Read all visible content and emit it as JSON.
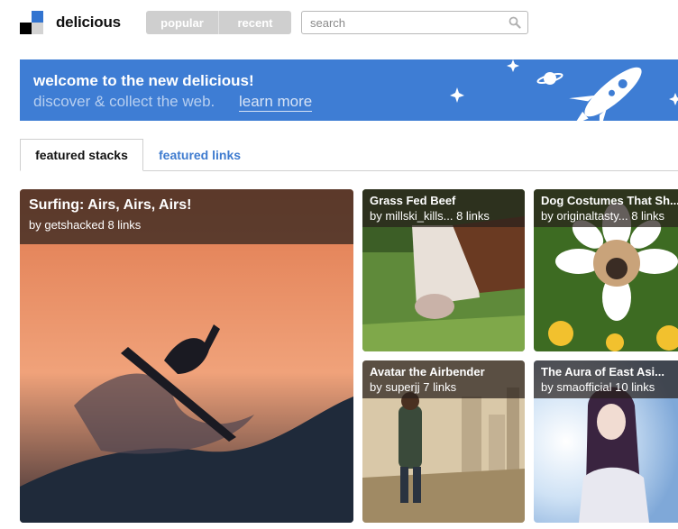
{
  "header": {
    "brand": "delicious",
    "nav": [
      "popular",
      "recent"
    ],
    "search_placeholder": "search"
  },
  "banner": {
    "title": "welcome to the new delicious!",
    "subtitle": "discover & collect the web.",
    "link": "learn more"
  },
  "tabs": [
    "featured stacks",
    "featured links"
  ],
  "stacks": [
    {
      "title": "Surfing: Airs, Airs, Airs!",
      "meta": "by getshacked 8 links"
    },
    {
      "title": "Grass Fed Beef",
      "meta": "by millski_kills... 8 links"
    },
    {
      "title": "Dog Costumes That Sh...",
      "meta": "by originaltasty... 8 links"
    },
    {
      "title": "Avatar the Airbender",
      "meta": "by superjj 7 links"
    },
    {
      "title": "The Aura of East Asi...",
      "meta": "by smaofficial 10 links"
    }
  ],
  "colors": {
    "banner_bg": "#3e7dd4",
    "link_blue": "#3e7bcf",
    "nav_gray": "#cfcfcf"
  }
}
